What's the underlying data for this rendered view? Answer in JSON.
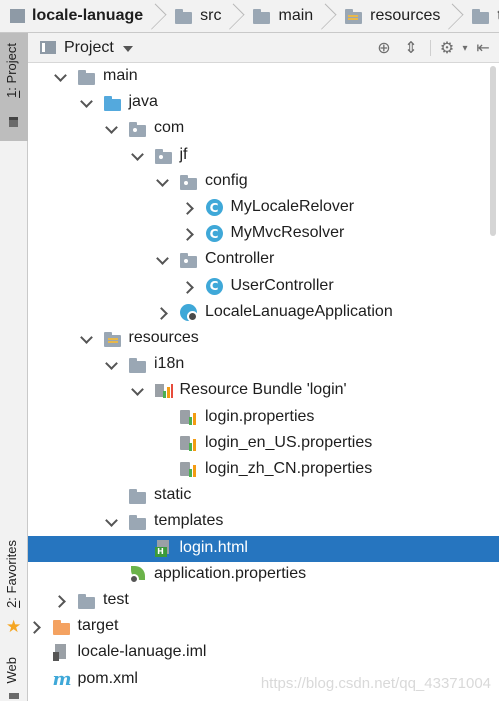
{
  "breadcrumbs": [
    "locale-lanuage",
    "src",
    "main",
    "resources",
    "template"
  ],
  "left_strip": {
    "project_tab": {
      "num": "1",
      "rest": ": Project"
    },
    "favorites_tab": {
      "num": "2",
      "rest": ": Favorites"
    },
    "web_tab": "Web"
  },
  "panel": {
    "title": "Project"
  },
  "tree": [
    {
      "label": "main",
      "depth": 1,
      "arrow": "down",
      "icon": "folder-icon",
      "color": "#9aa7b4"
    },
    {
      "label": "java",
      "depth": 2,
      "arrow": "down",
      "icon": "folder-icon",
      "color": "#54a9dd"
    },
    {
      "label": "com",
      "depth": 3,
      "arrow": "down",
      "icon": "package-icon",
      "color": "#9aa7b4"
    },
    {
      "label": "jf",
      "depth": 4,
      "arrow": "down",
      "icon": "package-icon",
      "color": "#9aa7b4"
    },
    {
      "label": "config",
      "depth": 5,
      "arrow": "down",
      "icon": "package-icon",
      "color": "#9aa7b4"
    },
    {
      "label": "MyLocaleRelover",
      "depth": 6,
      "arrow": "right",
      "icon": "class-icon"
    },
    {
      "label": "MyMvcResolver",
      "depth": 6,
      "arrow": "right",
      "icon": "class-icon"
    },
    {
      "label": "Controller",
      "depth": 5,
      "arrow": "down",
      "icon": "package-icon",
      "color": "#9aa7b4"
    },
    {
      "label": "UserController",
      "depth": 6,
      "arrow": "right",
      "icon": "class-icon"
    },
    {
      "label": "LocaleLanuageApplication",
      "depth": 5,
      "arrow": "right",
      "icon": "spring-app-icon"
    },
    {
      "label": "resources",
      "depth": 2,
      "arrow": "down",
      "icon": "resources-folder-icon",
      "color": "#9aa7b4"
    },
    {
      "label": "i18n",
      "depth": 3,
      "arrow": "down",
      "icon": "folder-icon",
      "color": "#9aa7b4"
    },
    {
      "label": "Resource Bundle 'login'",
      "depth": 4,
      "arrow": "down",
      "icon": "resource-bundle-icon"
    },
    {
      "label": "login.properties",
      "depth": 5,
      "arrow": "none",
      "icon": "properties-file-icon"
    },
    {
      "label": "login_en_US.properties",
      "depth": 5,
      "arrow": "none",
      "icon": "properties-file-icon"
    },
    {
      "label": "login_zh_CN.properties",
      "depth": 5,
      "arrow": "none",
      "icon": "properties-file-icon"
    },
    {
      "label": "static",
      "depth": 3,
      "arrow": "none",
      "icon": "folder-icon",
      "color": "#9aa7b4"
    },
    {
      "label": "templates",
      "depth": 3,
      "arrow": "down",
      "icon": "folder-icon",
      "color": "#9aa7b4"
    },
    {
      "label": "login.html",
      "depth": 4,
      "arrow": "none",
      "icon": "html-file-icon",
      "selected": true
    },
    {
      "label": "application.properties",
      "depth": 3,
      "arrow": "none",
      "icon": "spring-properties-icon"
    },
    {
      "label": "test",
      "depth": 1,
      "arrow": "right",
      "icon": "folder-icon",
      "color": "#9aa7b4"
    },
    {
      "label": "target",
      "depth": 0,
      "arrow": "right",
      "icon": "folder-icon",
      "color": "#f4a261"
    },
    {
      "label": "locale-lanuage.iml",
      "depth": 0,
      "arrow": "none",
      "icon": "iml-file-icon"
    },
    {
      "label": "pom.xml",
      "depth": 0,
      "arrow": "none",
      "icon": "maven-icon"
    }
  ],
  "watermark": "https://blog.csdn.net/qq_43371004"
}
